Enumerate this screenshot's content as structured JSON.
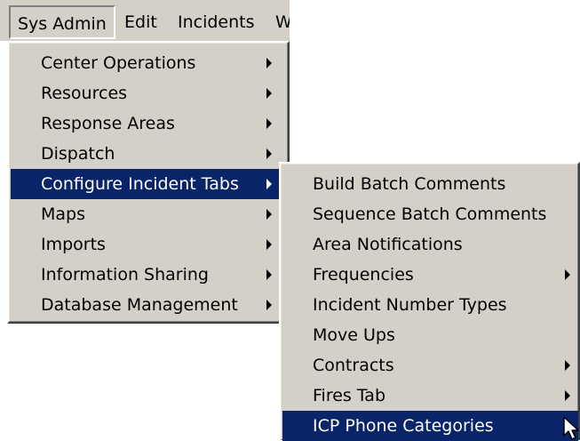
{
  "menubar": {
    "items": [
      {
        "label": "Sys Admin"
      },
      {
        "label": "Edit"
      },
      {
        "label": "Incidents"
      },
      {
        "label": "W"
      }
    ]
  },
  "sysadmin_menu": {
    "items": [
      {
        "label": "Center Operations",
        "has_submenu": true
      },
      {
        "label": "Resources",
        "has_submenu": true
      },
      {
        "label": "Response Areas",
        "has_submenu": true
      },
      {
        "label": "Dispatch",
        "has_submenu": true
      },
      {
        "label": "Configure Incident Tabs",
        "has_submenu": true,
        "highlighted": true
      },
      {
        "label": "Maps",
        "has_submenu": true
      },
      {
        "label": "Imports",
        "has_submenu": true
      },
      {
        "label": "Information Sharing",
        "has_submenu": true
      },
      {
        "label": "Database Management",
        "has_submenu": true
      }
    ]
  },
  "configure_submenu": {
    "items": [
      {
        "label": "Build Batch Comments",
        "has_submenu": false
      },
      {
        "label": "Sequence Batch Comments",
        "has_submenu": false
      },
      {
        "label": "Area Notifications",
        "has_submenu": false
      },
      {
        "label": "Frequencies",
        "has_submenu": true
      },
      {
        "label": "Incident Number Types",
        "has_submenu": false
      },
      {
        "label": "Move Ups",
        "has_submenu": false
      },
      {
        "label": "Contracts",
        "has_submenu": true
      },
      {
        "label": "Fires Tab",
        "has_submenu": true
      },
      {
        "label": "ICP Phone Categories",
        "has_submenu": false,
        "highlighted": true
      }
    ]
  },
  "colors": {
    "menu_bg": "#d4d0c8",
    "highlight_bg": "#0a246a",
    "highlight_text": "#ffffff"
  },
  "icons": {
    "submenu_arrow": "chevron-right-icon",
    "cursor": "mouse-pointer-icon"
  }
}
